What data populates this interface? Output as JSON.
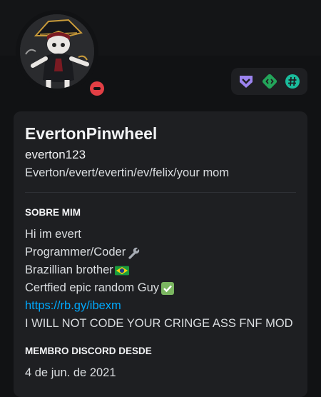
{
  "profile": {
    "display_name": "EvertonPinwheel",
    "username": "everton123",
    "pronouns": "Everton/evert/evertin/ev/felix/your mom",
    "status": "do-not-disturb",
    "avatar_icon": "cartoon-pirate-character-avatar"
  },
  "badges": [
    {
      "icon": "hypesquad-badge-icon",
      "color": "#9c84ef"
    },
    {
      "icon": "active-developer-badge-icon",
      "color": "#23a55a"
    },
    {
      "icon": "hashtag-badge-icon",
      "color": "#1abc9c"
    }
  ],
  "about": {
    "title": "SOBRE MIM",
    "lines": [
      {
        "text": "Hi im evert"
      },
      {
        "text": "Programmer/Coder",
        "emoji": "wrench-emoji"
      },
      {
        "text": "Brazillian brother",
        "emoji": "brazil-flag-emoji"
      },
      {
        "text": "Certfied epic random Guy",
        "emoji": "check-mark-emoji"
      },
      {
        "text": "https://rb.gy/ibexm",
        "link": true
      },
      {
        "text": "I WILL NOT CODE YOUR CRINGE ASS FNF MOD"
      }
    ]
  },
  "member_since": {
    "title": "MEMBRO DISCORD DESDE",
    "date": "4 de jun. de 2021"
  },
  "colors": {
    "background": "#111214",
    "card": "#1e1f22",
    "link": "#00a8fc",
    "dnd": "#e23f45"
  }
}
